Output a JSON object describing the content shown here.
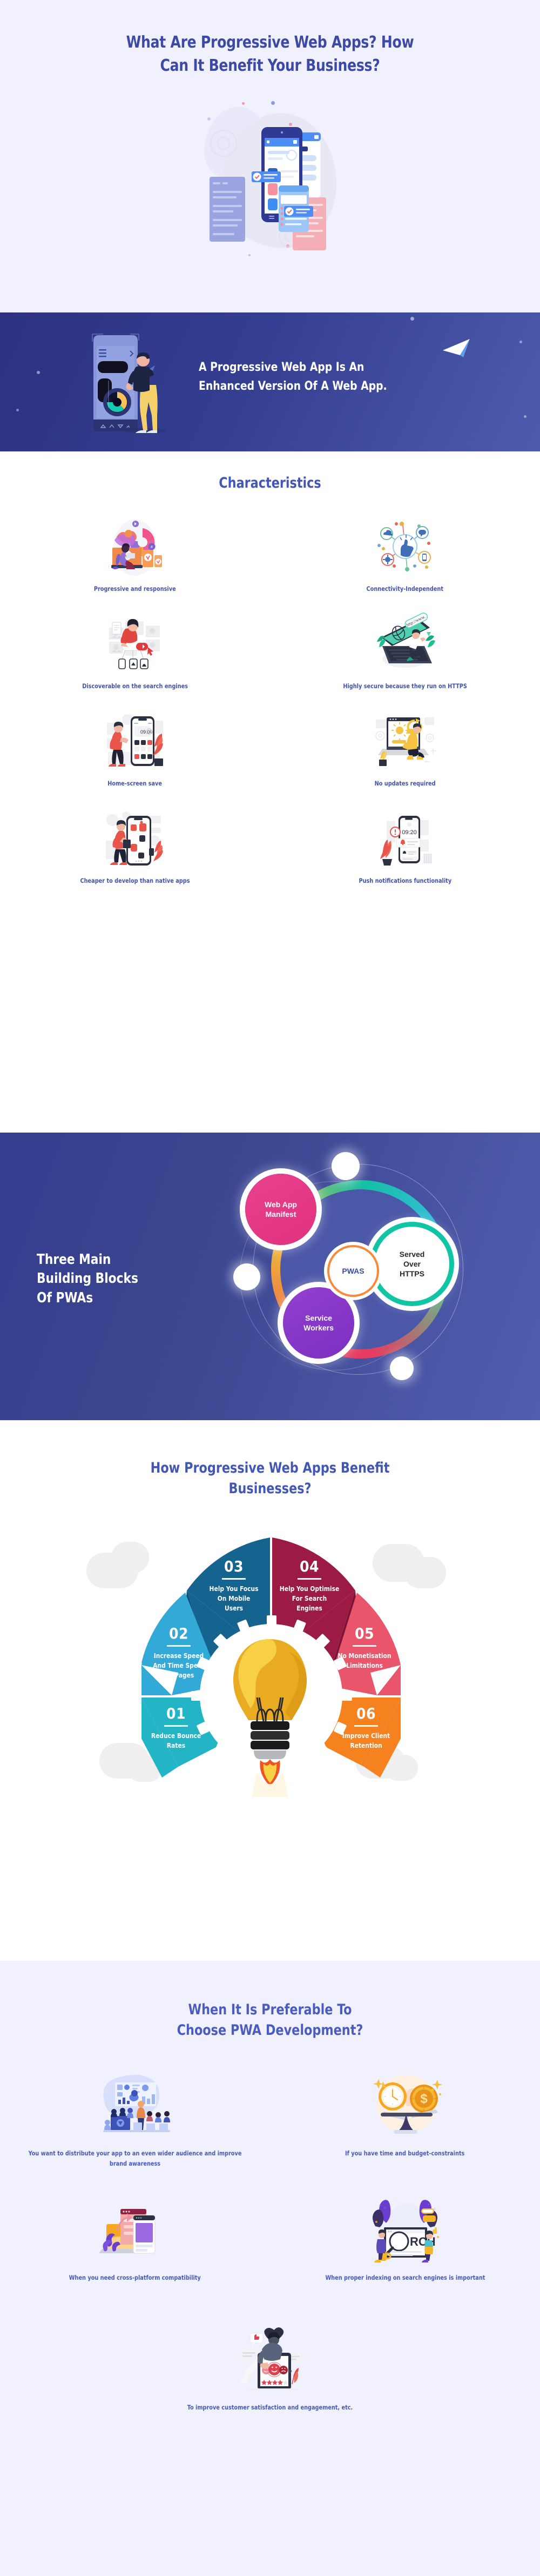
{
  "hero": {
    "title_line1": "What Are Progressive Web Apps? How",
    "title_line2": "Can It Benefit Your Business?",
    "illustration": "pwa-devices-illustration"
  },
  "banner": {
    "title_line1": "A Progressive Web App Is An",
    "title_line2": "Enhanced Version Of A Web App.",
    "illustration": "man-with-phone-illustration",
    "accent_icon": "paper-plane-icon",
    "bg_color": "#343e91"
  },
  "characteristics": {
    "title": "Characteristics",
    "items": [
      {
        "label": "Progressive and responsive",
        "icon": "responsive-devices-icon"
      },
      {
        "label": "Connectivity-Independent",
        "icon": "network-nodes-icon"
      },
      {
        "label": "Discoverable on the search engines",
        "icon": "search-discover-icon"
      },
      {
        "label": "Highly secure because they run on HTTPS",
        "icon": "laptop-https-icon"
      },
      {
        "label": "Home-screen save",
        "icon": "phone-homescreen-icon"
      },
      {
        "label": "No updates required",
        "icon": "laptop-update-icon"
      },
      {
        "label": "Cheaper to develop than native apps",
        "icon": "phone-apps-icon"
      },
      {
        "label": "Push notifications functionality",
        "icon": "push-notification-icon"
      }
    ]
  },
  "building_blocks": {
    "title_line1": "Three Main",
    "title_line2": "Building Blocks",
    "title_line3": "Of PWAs",
    "center_label": "PWAS",
    "nodes": [
      {
        "label_line1": "Web App",
        "label_line2": "Manifest",
        "color": "#e3327f"
      },
      {
        "label_line1": "Service",
        "label_line2": "Workers",
        "color": "#8a35c8"
      },
      {
        "label_line1": "Served",
        "label_line2": "Over",
        "label_line3": "HTTPS",
        "color": "#10c5a4"
      }
    ],
    "center_ring_color": "#f5893c"
  },
  "benefits": {
    "title_line1": "How Progressive Web Apps Benefit",
    "title_line2": "Businesses?",
    "center_icon": "rocket-lightbulb-icon",
    "chart_data": {
      "type": "pie",
      "title": "How Progressive Web Apps Benefit Businesses?",
      "legend": "none",
      "categories": [
        "01",
        "02",
        "03",
        "04",
        "05",
        "06"
      ],
      "values": [
        1,
        1,
        1,
        1,
        1,
        1
      ],
      "labels": [
        "Reduce Bounce Rates",
        "Increase Speed And Time Spent On Pages",
        "Help You Focus On Mobile Users",
        "Help You Optimise For Search Engines",
        "No Monetisation Limitations",
        "Improve Client Retention"
      ],
      "colors": [
        "#23b5c6",
        "#33a9d8",
        "#15638f",
        "#9c1b44",
        "#e9556a",
        "#f5821f"
      ]
    },
    "segments": [
      {
        "num": "01",
        "text_lines": [
          "Reduce Bounce",
          "Rates"
        ],
        "color": "#23b5c6"
      },
      {
        "num": "02",
        "text_lines": [
          "Increase Speed",
          "And Time Spent",
          "On Pages"
        ],
        "color": "#33a9d8"
      },
      {
        "num": "03",
        "text_lines": [
          "Help You Focus",
          "On Mobile",
          "Users"
        ],
        "color": "#15638f"
      },
      {
        "num": "04",
        "text_lines": [
          "Help You Optimise",
          "For Search",
          "Engines"
        ],
        "color": "#9c1b44"
      },
      {
        "num": "05",
        "text_lines": [
          "No Monetisation",
          "Limitations"
        ],
        "color": "#e9556a"
      },
      {
        "num": "06",
        "text_lines": [
          "Improve Client",
          "Retention"
        ],
        "color": "#f5821f"
      }
    ]
  },
  "preferable": {
    "title_line1": "When It Is Preferable To",
    "title_line2": "Choose PWA Development?",
    "items": [
      {
        "label": "You want to distribute your app to an even wider audience and improve brand awareness",
        "icon": "presentation-audience-icon"
      },
      {
        "label": "If you have time and budget-constraints",
        "icon": "clock-coin-balance-icon"
      },
      {
        "label": "When you need cross-platform compatibility",
        "icon": "multi-device-icon"
      },
      {
        "label": "When proper indexing on search engines is important",
        "icon": "search-magnifier-icon"
      },
      {
        "label": "To improve customer satisfaction and engagement, etc.",
        "icon": "customer-rating-icon"
      }
    ]
  },
  "theme": {
    "page_bg": "#f0f1fd",
    "heading_color": "#3c4aa6",
    "white_bg": "#ffffff"
  }
}
